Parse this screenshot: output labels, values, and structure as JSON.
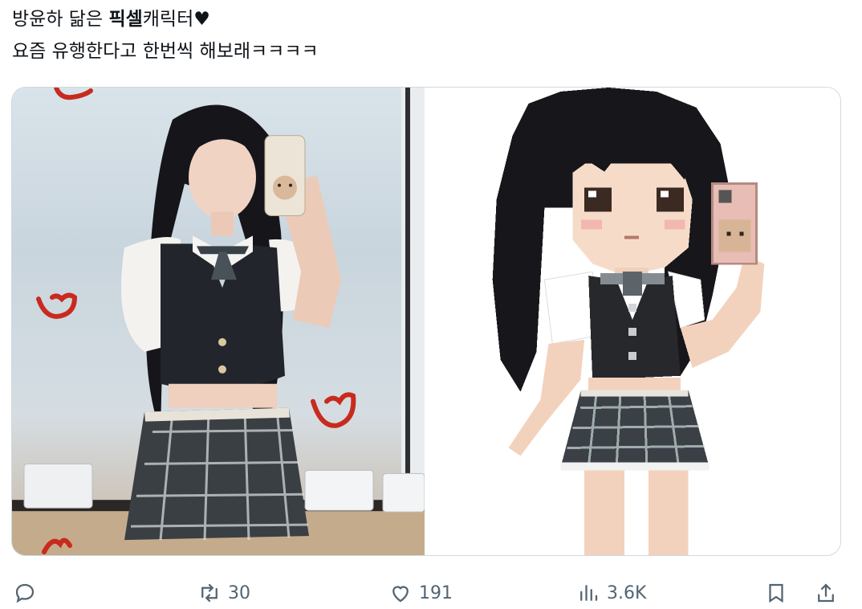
{
  "tweet": {
    "text_line1_prefix": "방윤하 닮은 ",
    "text_line1_bold": "픽셀",
    "text_line1_suffix": "캐릭터",
    "text_line1_heart": "♥",
    "text_line2": "요즘 유행한다고 한번씩 해보래ㅋㅋㅋㅋ"
  },
  "media": {
    "left_image": "photo-of-person-mirror-selfie",
    "right_image": "pixel-art-character"
  },
  "actions": {
    "reply_count": "",
    "retweet_count": "30",
    "like_count": "191",
    "views_count": "3.6K"
  },
  "colors": {
    "text": "#0f1419",
    "muted": "#536471",
    "border": "#cfd9de",
    "sticker_red": "#c92a1e"
  },
  "icons": [
    "reply-icon",
    "retweet-icon",
    "like-icon",
    "views-icon",
    "bookmark-icon",
    "share-icon"
  ]
}
